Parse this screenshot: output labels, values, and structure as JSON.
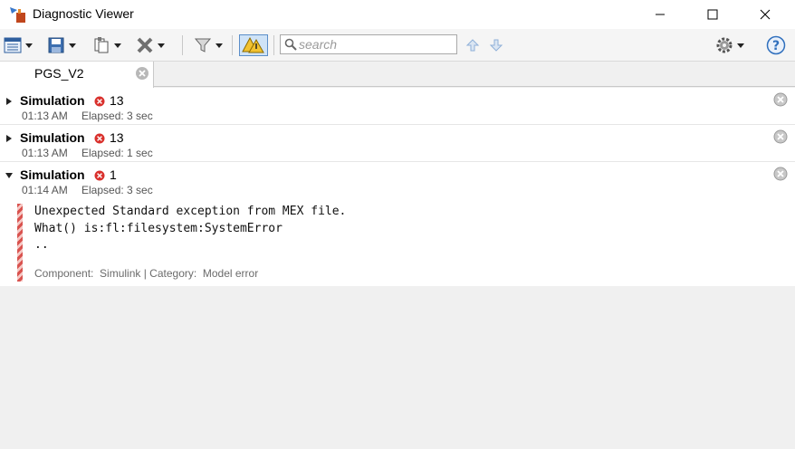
{
  "window": {
    "title": "Diagnostic Viewer",
    "min_glyph": "—",
    "max_glyph": "☐",
    "close_glyph": "✕"
  },
  "toolbar": {
    "search": {
      "placeholder": "search",
      "value": ""
    },
    "icons": [
      "view-options-icon",
      "save-icon",
      "copy-icon",
      "clear-icon",
      "filter-icon",
      "warnings-toggle-icon",
      "search-icon",
      "up-arrow-icon",
      "down-arrow-icon",
      "gear-icon",
      "help-icon"
    ]
  },
  "tab": {
    "label": "PGS_V2"
  },
  "entries": [
    {
      "title": "Simulation",
      "count": "13",
      "time": "01:13 AM",
      "elapsed": "Elapsed: 3 sec",
      "expanded": false
    },
    {
      "title": "Simulation",
      "count": "13",
      "time": "01:13 AM",
      "elapsed": "Elapsed: 1 sec",
      "expanded": false
    },
    {
      "title": "Simulation",
      "count": "1",
      "time": "01:14 AM",
      "elapsed": "Elapsed: 3 sec",
      "expanded": true,
      "message": {
        "lines": [
          "Unexpected Standard exception from MEX file.",
          "What() is:fl:filesystem:SystemError",
          ".."
        ],
        "meta": "Component:  Simulink | Category:  Model error"
      }
    }
  ],
  "colors": {
    "error": "#d9302c",
    "toggle_active": "#cfe3f7",
    "toggle_border": "#5b8ec9"
  }
}
